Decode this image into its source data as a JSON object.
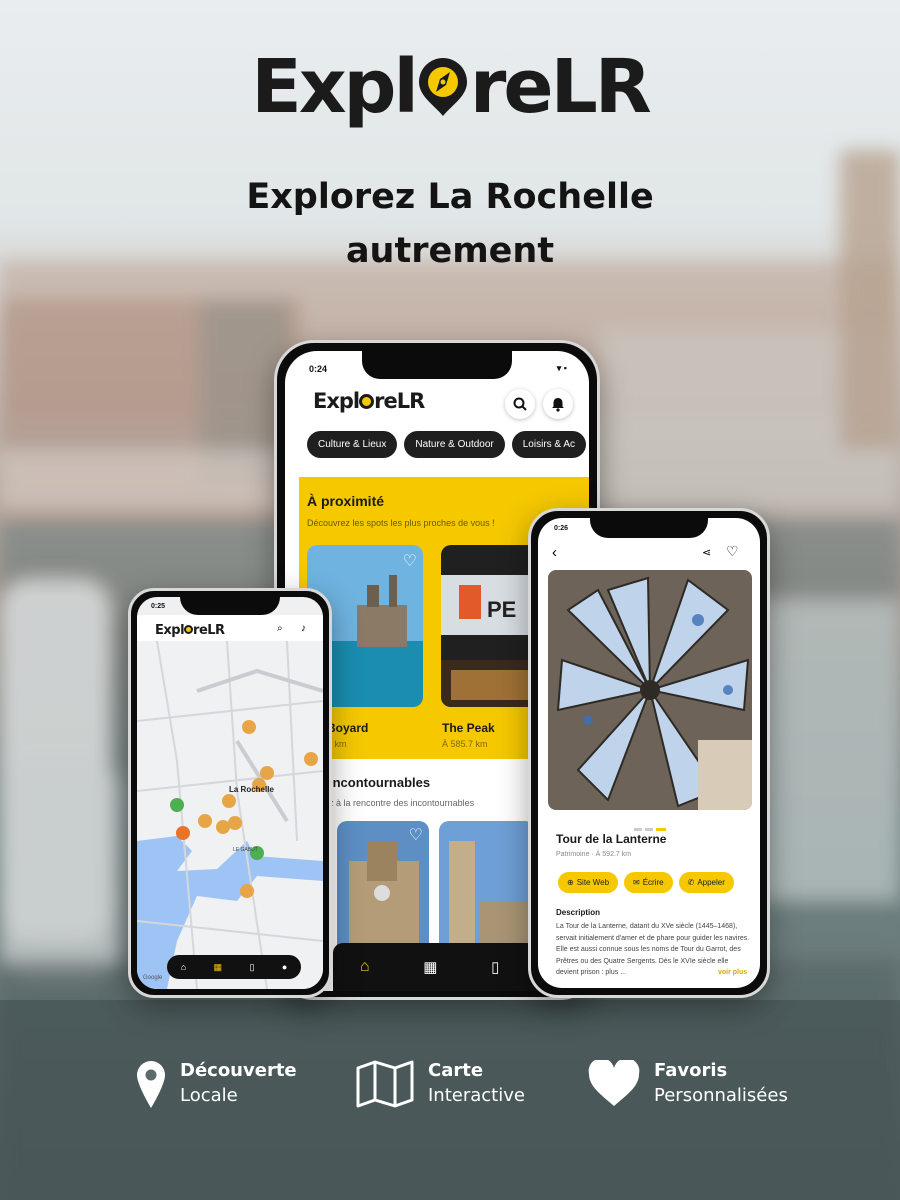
{
  "brand": {
    "logo_pre": "Expl",
    "logo_post": "reLR",
    "accent": "#f5c800",
    "dark": "#1b1b1b"
  },
  "tagline": {
    "line1": "Explorez La Rochelle",
    "line2": "autrement"
  },
  "center_phone": {
    "time": "0:24",
    "logo_pre": "Expl",
    "logo_post": "reLR",
    "chips": [
      "Culture & Lieux",
      "Nature & Outdoor",
      "Loisirs & Ac"
    ],
    "nearby": {
      "title": "À proximité",
      "subtitle": "Découvrez les spots les plus proches de vous !"
    },
    "nearby_cards": [
      {
        "name": "Boyard",
        "dist": "5 km"
      },
      {
        "name": "The Peak",
        "dist": "À 585.7 km"
      }
    ],
    "sign_text": "PE",
    "must": {
      "title": "incontournables",
      "subtitle": "z à la rencontre des incontournables"
    },
    "nav": [
      "home-icon",
      "map-icon",
      "bookmark-icon",
      "user-icon"
    ]
  },
  "left_phone": {
    "time": "0:25",
    "logo_pre": "Expl",
    "logo_post": "reLR",
    "map_label": "La Rochelle",
    "map_label2": "LE GABUT",
    "google": "Google"
  },
  "right_phone": {
    "time": "0:26",
    "place": {
      "name": "Tour de la Lanterne",
      "meta": "Patrimoine · À 592.7 km"
    },
    "actions": [
      {
        "icon": "globe-icon",
        "label": "Site Web"
      },
      {
        "icon": "mail-icon",
        "label": "Écrire"
      },
      {
        "icon": "phone-icon",
        "label": "Appeler"
      }
    ],
    "description_title": "Description",
    "description": "La Tour de la Lanterne, datant du XVe siècle (1445–1468), servait initialement d'amer et de phare pour guider les navires. Elle est aussi connue sous les noms de Tour du Garrot, des Prêtres ou des Quatre Sergents. Dès le XVIe siècle elle devient prison : plus ...",
    "read_more": "voir plus"
  },
  "features": [
    {
      "icon": "location-pin-icon",
      "title": "Découverte",
      "subtitle": "Locale"
    },
    {
      "icon": "map-icon",
      "title": "Carte",
      "subtitle": "Interactive"
    },
    {
      "icon": "heart-icon",
      "title": "Favoris",
      "subtitle": "Personnalisées"
    }
  ]
}
